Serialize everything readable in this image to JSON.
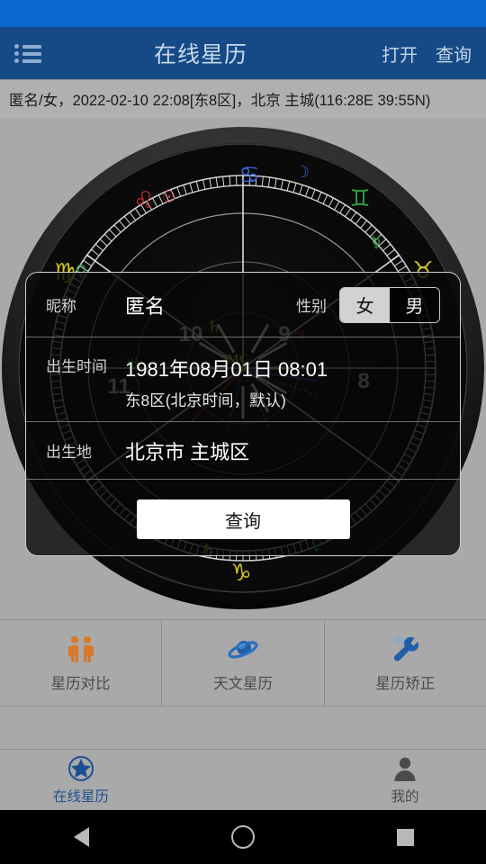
{
  "header": {
    "title": "在线星历",
    "menu_icon": "list-icon",
    "actions": [
      {
        "label": "打开",
        "name": "open-action"
      },
      {
        "label": "查询",
        "name": "query-action"
      }
    ]
  },
  "info_bar": {
    "text": "匿名/女，2022-02-10 22:08[东8区]，北京 主城(116:28E 39:55N)"
  },
  "chart": {
    "center_label": "MC",
    "house_numbers": [
      "8",
      "9",
      "10",
      "11"
    ],
    "zodiac_glyphs": [
      "♋",
      "♌",
      "♍",
      "♊",
      "♉",
      "♑"
    ],
    "planet_glyphs": [
      "☉",
      "☽",
      "♄",
      "♃",
      "☿",
      "♀",
      "♅"
    ]
  },
  "dialog": {
    "nickname": {
      "label": "昵称",
      "value": "匿名"
    },
    "gender": {
      "label": "性别",
      "options": [
        "女",
        "男"
      ],
      "selected": "女"
    },
    "birth_time": {
      "label": "出生时间",
      "value": "1981年08月01日 08:01",
      "timezone": "东8区(北京时间，默认)"
    },
    "birth_place": {
      "label": "出生地",
      "value": "北京市 主城区"
    },
    "submit_label": "查询"
  },
  "features": [
    {
      "label": "星历对比",
      "icon": "two-people-icon",
      "name": "feature-compare"
    },
    {
      "label": "天文星历",
      "icon": "planet-icon",
      "name": "feature-astronomy"
    },
    {
      "label": "星历矫正",
      "icon": "wrench-icon",
      "name": "feature-rectify"
    }
  ],
  "tabs": [
    {
      "label": "在线星历",
      "icon": "star-circle-icon",
      "active": true,
      "name": "tab-online-ephemeris"
    },
    {
      "label": "我的",
      "icon": "person-icon",
      "active": false,
      "name": "tab-mine"
    }
  ],
  "navbar": {
    "back": "back-triangle-icon",
    "home": "home-circle-icon",
    "recent": "recent-square-icon"
  },
  "colors": {
    "status_bar": "#0b68cf",
    "header": "#164a87",
    "page_bg": "#a9a9a9",
    "accent_blue": "#1f4f93"
  }
}
